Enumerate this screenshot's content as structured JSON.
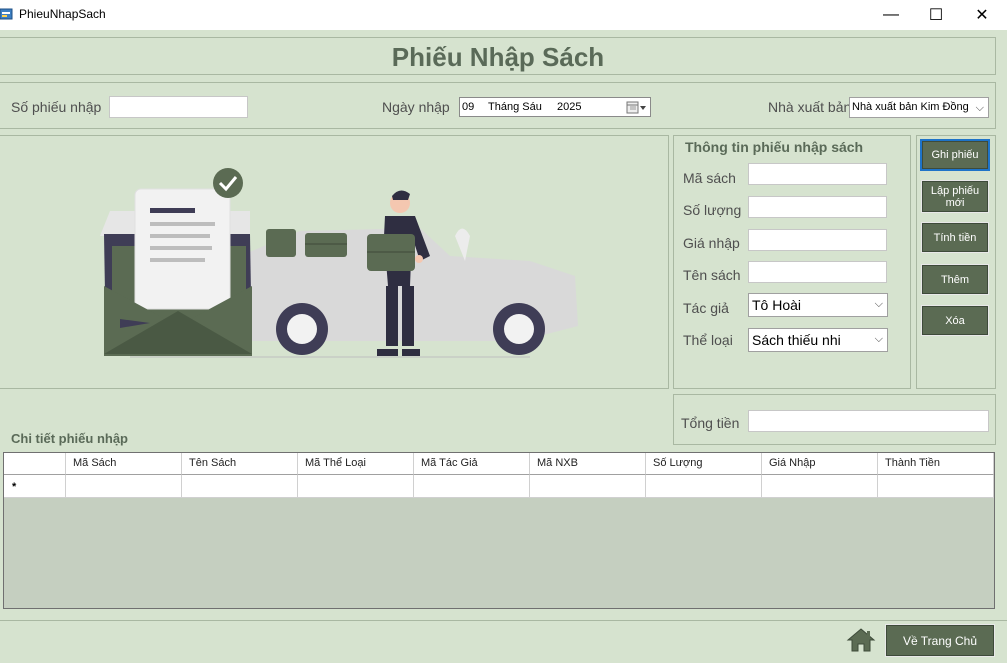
{
  "window": {
    "title": "PhieuNhapSach",
    "minimize": "—",
    "maximize": "☐",
    "close": "✕"
  },
  "form_title": "Phiếu Nhập Sách",
  "header": {
    "so_phieu_label": "Số phiếu nhập",
    "so_phieu_value": "",
    "ngay_nhap_label": "Ngày nhập",
    "date": {
      "day": "09",
      "month": "Tháng Sáu",
      "year": "2025"
    },
    "nxb_label": "Nhà xuất bản",
    "nxb_value": "Nhà xuất bản Kim Đồng"
  },
  "info": {
    "title": "Thông tin phiếu nhập sách",
    "ma_sach_label": "Mã sách",
    "so_luong_label": "Số lượng",
    "gia_nhap_label": "Giá nhập",
    "ten_sach_label": "Tên sách",
    "tac_gia_label": "Tác giả",
    "tac_gia_value": "Tô Hoài",
    "the_loai_label": "Thể loại",
    "the_loai_value": "Sách thiếu nhi",
    "tong_tien_label": "Tổng tiền"
  },
  "actions": {
    "ghi_phieu": "Ghi phiếu",
    "lap_phieu_moi": "Lập phiếu mới",
    "tinh_tien": "Tính tiền",
    "them": "Thêm",
    "xoa": "Xóa"
  },
  "details": {
    "label": "Chi tiết phiếu nhập",
    "columns": [
      "Mã Sách",
      "Tên Sách",
      "Mã Thể Loại",
      "Mã Tác Giả",
      "Mã NXB",
      "Số Lượng",
      "Giá Nhập",
      "Thành Tiền"
    ],
    "new_row_marker": "*"
  },
  "footer": {
    "home_button": "Về Trang Chủ"
  },
  "colors": {
    "background": "#d6e3cf",
    "button": "#5b6b53",
    "title": "#5a6a58"
  }
}
